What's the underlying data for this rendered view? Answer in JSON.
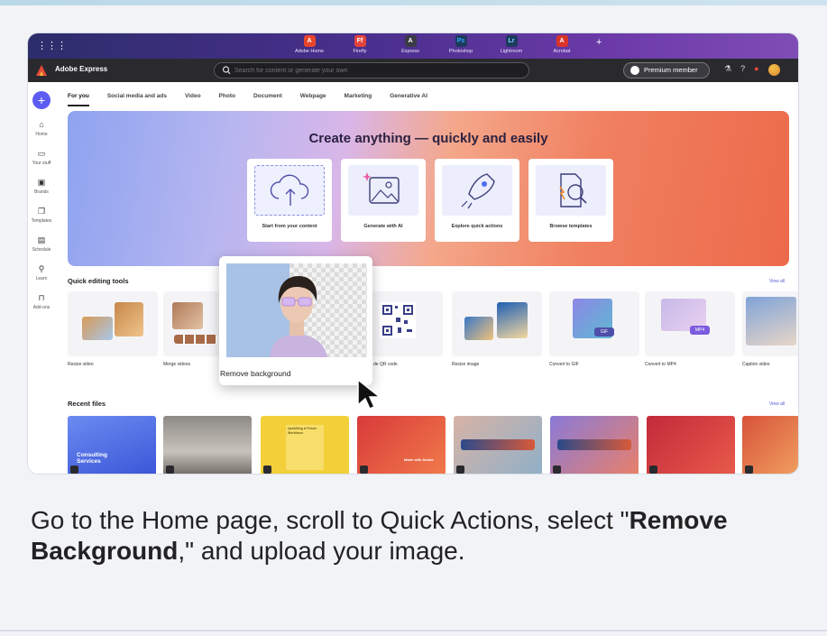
{
  "apps": [
    {
      "label": "Adobe Home",
      "glyph": "A",
      "color": "#e8462b"
    },
    {
      "label": "Firefly",
      "glyph": "Ff",
      "color": "#e2433a"
    },
    {
      "label": "Express",
      "glyph": "A",
      "color": "#3b3b45"
    },
    {
      "label": "Photoshop",
      "glyph": "Ps",
      "color": "#1d3b5e"
    },
    {
      "label": "Lightroom",
      "glyph": "Lr",
      "color": "#1d3b5e"
    },
    {
      "label": "Acrobat",
      "glyph": "A",
      "color": "#d8342a"
    }
  ],
  "header": {
    "brand": "Adobe Express",
    "search_placeholder": "Search for content or generate your own",
    "premium_label": "Premium member"
  },
  "rail": [
    {
      "label": "Home",
      "icon": "⌂"
    },
    {
      "label": "Your stuff",
      "icon": "▭"
    },
    {
      "label": "Brands",
      "icon": "▣"
    },
    {
      "label": "Templates",
      "icon": "❐"
    },
    {
      "label": "Schedule",
      "icon": "▤"
    },
    {
      "label": "Learn",
      "icon": "⚲"
    },
    {
      "label": "Add-ons",
      "icon": "⊓"
    }
  ],
  "tabs": [
    "For you",
    "Social media and ads",
    "Video",
    "Photo",
    "Document",
    "Webpage",
    "Marketing",
    "Generative AI"
  ],
  "hero": {
    "title": "Create anything — quickly and easily",
    "cards": [
      "Start from your content",
      "Generate with AI",
      "Explore quick actions",
      "Browse templates"
    ]
  },
  "quick_tools": {
    "title": "Quick editing tools",
    "view_all": "View all",
    "items": [
      "Resize video",
      "Merge videos",
      "de QR code",
      "Resize image",
      "Convert to GIF",
      "Convert to MP4",
      "Caption video"
    ]
  },
  "recent_files": {
    "title": "Recent files",
    "view_all": "View all",
    "consulting": "Consulting Services",
    "wordmark": "Upskilling & Future Workforce",
    "made_with": "Made with Adobe"
  },
  "popup": {
    "label": "Remove background"
  },
  "caption": {
    "before": "Go to the Home page, scroll to Quick Actions, select \"",
    "bold": "Remove Background",
    "after": ",\" and upload your image."
  },
  "colors": {
    "accent": "#5d5cf2",
    "header_bg": "#2a2a2e"
  }
}
